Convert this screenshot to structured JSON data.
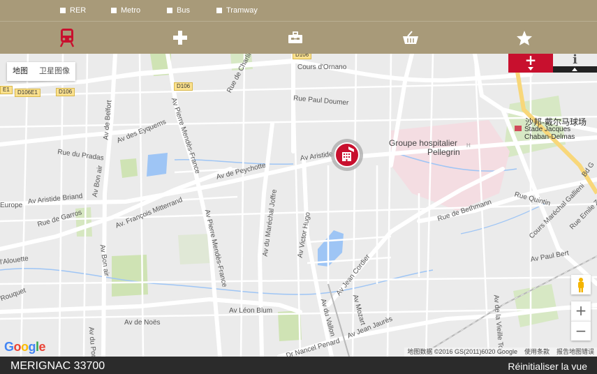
{
  "filters": [
    {
      "label": "RER"
    },
    {
      "label": "Metro"
    },
    {
      "label": "Bus"
    },
    {
      "label": "Tramway"
    }
  ],
  "categories": [
    {
      "icon": "train-icon",
      "active": true
    },
    {
      "icon": "medical-cross-icon",
      "active": false
    },
    {
      "icon": "toolbox-icon",
      "active": false
    },
    {
      "icon": "shopping-basket-icon",
      "active": false
    },
    {
      "icon": "star-icon",
      "active": false
    }
  ],
  "map": {
    "maptype": {
      "map_label": "地图",
      "satellite_label": "卫星图像"
    },
    "place_labels": {
      "hospital": "Groupe hospitalier",
      "hospital2": "Pellegrin",
      "stadium_cn": "沙邦-戴尔马球场",
      "stadium1": "Stade Jacques",
      "stadium2": "Chaban-Delmas"
    },
    "streets": {
      "ornano": "Cours d'Ornano",
      "charlin": "Rue de Charlin",
      "doumer": "Rue Paul Doumer",
      "belfort": "Av de Belfort",
      "pmf": "Av Pierre Mendès-France",
      "pmf2": "Av Pierre Mendès-France",
      "eyquems": "Av des Eyquems",
      "pradas": "Rue du Pradas",
      "peychotte": "Av de Peychotte",
      "briand": "Av Aristide Briand",
      "briand2": "Av Aristide Briand",
      "mitterrand": "Av. François Mitterrand",
      "europe": "Europe",
      "garros": "Rue de Garros",
      "bonair": "Av Bon air",
      "bonair2": "Av Bon air",
      "alouette": "l'Alouette",
      "joffre": "Av du Maréchal Joffre",
      "hugo": "Av Victor Hugo",
      "bethmann": "Rue de Bethmann",
      "quintin": "Rue Quintin",
      "gallieni": "Cours Maréchal Gallieni",
      "zola": "Rue Emile Zola",
      "bert": "Av Paul Bert",
      "cordier": "Av Jean Cordier",
      "mozart": "Av Mozart",
      "vallon": "Av du Vallon",
      "blum": "Av Léon Blum",
      "noes": "Av de Noës",
      "jaures": "Av Jean Jaurès",
      "penard": "Dr Nancel Penard",
      "vieille": "Av de la Vieille Tour",
      "rouquet": "Rouquet",
      "pont": "Av du Pont",
      "bdg": "Bd G"
    },
    "road_tags": {
      "d106_top": "D106",
      "d106_left": "D106",
      "d106e1a": "E1",
      "d106e1b": "D106E1",
      "d106_b": "D106"
    },
    "zoom_in": "+",
    "zoom_out": "−",
    "google": "Google",
    "attribution": {
      "data": "地图数据 ©2016 GS(2011)6020 Google",
      "terms": "使用条款",
      "report": "报告地图错误"
    },
    "plus_tab": "+",
    "info_tab": "i"
  },
  "footer": {
    "city": "MERIGNAC 33700",
    "reset": "Réinitialiser la vue"
  },
  "colors": {
    "brand_bar": "#a89a79",
    "accent_red": "#c8102e",
    "footer_bg": "#2b2b2b"
  }
}
